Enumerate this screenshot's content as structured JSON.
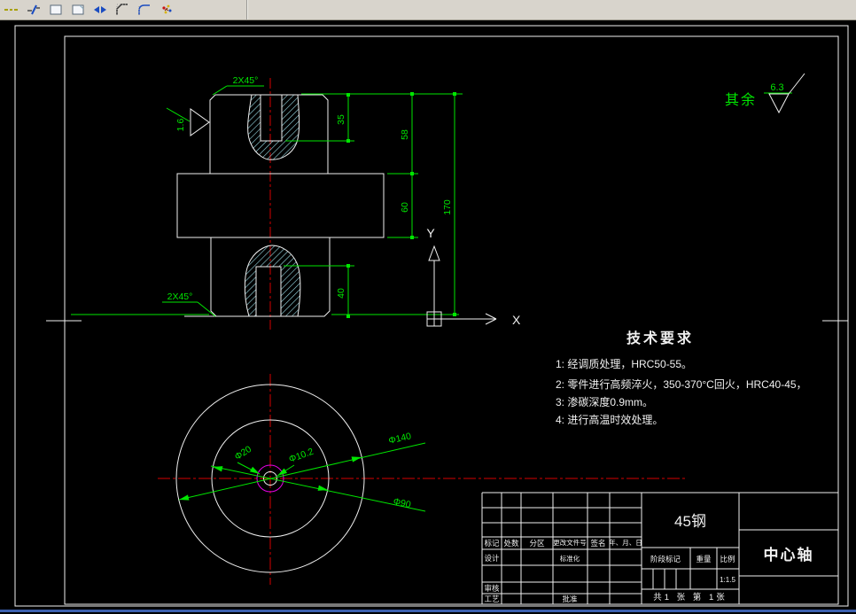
{
  "toolbar": {
    "icons": [
      "dash-line-icon",
      "breakline-icon",
      "rectangle-icon",
      "page-icon",
      "break-point-icon",
      "chamfer-icon",
      "fillet-icon",
      "explode-icon"
    ]
  },
  "drawing": {
    "general_roughness": {
      "prefix": "其余",
      "value": "6.3"
    },
    "local_roughness": "1.6",
    "chamfer_top": "2X45°",
    "chamfer_bottom": "2X45°",
    "dims": {
      "d58": "58",
      "d60": "60",
      "d170": "170",
      "d35": "35",
      "d40": "40"
    },
    "dia": {
      "d140": "Φ140",
      "d90": "Φ90",
      "d20": "Φ20",
      "d10_2": "Φ10.2"
    },
    "axes": {
      "x": "X",
      "y": "Y"
    }
  },
  "tech": {
    "title": "技术要求",
    "items": [
      "1: 经调质处理，HRC50-55。",
      "2: 零件进行高频淬火，350-370°C回火，HRC40-45，",
      "3: 渗碳深度0.9mm。",
      "4: 进行高温时效处理。"
    ]
  },
  "title_block": {
    "material": "45钢",
    "part_name": "中心轴",
    "cols": {
      "mark": "标记",
      "count": "处数",
      "zone": "分区",
      "change_doc": "更改文件号",
      "signature": "签名",
      "date": "年、月、日"
    },
    "rows": {
      "design": "设计",
      "standardization": "标准化",
      "review": "审核",
      "process": "工艺",
      "approve": "批准"
    },
    "stage_mark": "阶段标记",
    "weight": "重量",
    "scale_label": "比例",
    "scale_value": "1:1.5",
    "sheet_info": "共1 张 第 1张"
  }
}
